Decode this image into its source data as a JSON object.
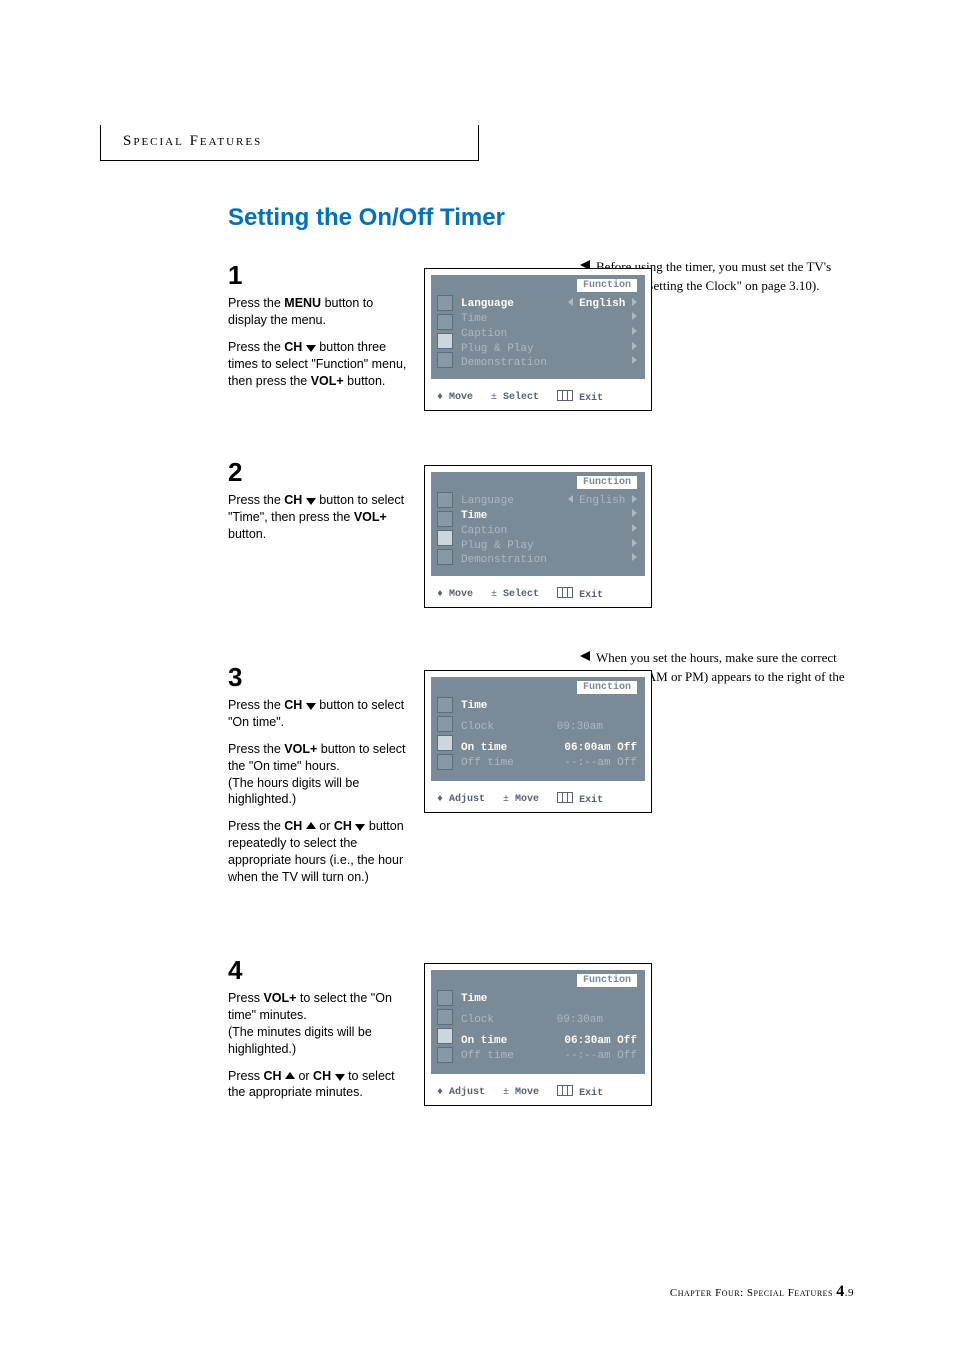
{
  "header": {
    "tab": "Special Features"
  },
  "title": "Setting the On/Off Timer",
  "steps": {
    "s1": {
      "num": "1",
      "p1a": "Press the ",
      "p1b": "MENU",
      "p1c": " button to display the menu.",
      "p2a": "Press the ",
      "p2b": "CH",
      "p2c": " button three times to select \"Function\" menu, then press the ",
      "p2d": "VOL+",
      "p2e": " button.",
      "osd": {
        "title": "Function",
        "lines": [
          {
            "label": "Language",
            "value": "English",
            "arrows": "lr",
            "hl": true
          },
          {
            "label": "Time",
            "value": "",
            "arrows": "r",
            "hl": false
          },
          {
            "label": "Caption",
            "value": "",
            "arrows": "r",
            "hl": false
          },
          {
            "label": "Plug & Play",
            "value": "",
            "arrows": "r",
            "hl": false
          },
          {
            "label": "Demonstration",
            "value": "",
            "arrows": "r",
            "hl": false
          }
        ],
        "footer": {
          "a": "Move",
          "b": "Select",
          "c": "Exit"
        }
      }
    },
    "s2": {
      "num": "2",
      "p1a": "Press the ",
      "p1b": "CH",
      "p1c": " button to select \"Time\", then press the  ",
      "p1d": "VOL+",
      "p1e": " button.",
      "osd": {
        "title": "Function",
        "lines": [
          {
            "label": "Language",
            "value": "English",
            "arrows": "lr",
            "hl": false
          },
          {
            "label": "Time",
            "value": "",
            "arrows": "r",
            "hl": true
          },
          {
            "label": "Caption",
            "value": "",
            "arrows": "r",
            "hl": false
          },
          {
            "label": "Plug & Play",
            "value": "",
            "arrows": "r",
            "hl": false
          },
          {
            "label": "Demonstration",
            "value": "",
            "arrows": "r",
            "hl": false
          }
        ],
        "footer": {
          "a": "Move",
          "b": "Select",
          "c": "Exit"
        }
      }
    },
    "s3": {
      "num": "3",
      "p1a": "Press the ",
      "p1b": "CH",
      "p1c": " button  to select \"On time\".",
      "p2a": "Press the ",
      "p2b": "VOL+",
      "p2c": " button to select the \"On time\" hours.",
      "p2d": "(The hours digits will be highlighted.)",
      "p3a": "Press the ",
      "p3b": "CH",
      "p3c": " or ",
      "p3d": "CH",
      "p3e": " button  repeatedly to select the appropriate hours (i.e., the hour when the TV will turn on.)",
      "osd": {
        "title": "Function",
        "heading": "Time",
        "rows": [
          {
            "label": "Clock",
            "value": "09:30am",
            "hl": false
          },
          {
            "label": "On time",
            "value": "06:00am Off",
            "hl": true
          },
          {
            "label": "Off time",
            "value": "--:--am Off",
            "hl": false
          }
        ],
        "footer": {
          "a": "Adjust",
          "b": "Move",
          "c": "Exit"
        }
      }
    },
    "s4": {
      "num": "4",
      "p1a": "Press ",
      "p1b": "VOL+",
      "p1c": " to select the \"On time\" minutes.",
      "p1d": "(The minutes digits will be highlighted.)",
      "p2a": "Press ",
      "p2b": "CH",
      "p2c": " or ",
      "p2d": "CH",
      "p2e": " to select the appropriate minutes.",
      "osd": {
        "title": "Function",
        "heading": "Time",
        "rows": [
          {
            "label": "Clock",
            "value": "09:30am",
            "hl": false
          },
          {
            "label": "On time",
            "value": "06:30am Off",
            "hl": true
          },
          {
            "label": "Off time",
            "value": "--:--am Off",
            "hl": false
          }
        ],
        "footer": {
          "a": "Adjust",
          "b": "Move",
          "c": "Exit"
        }
      }
    }
  },
  "notes": {
    "n1": "Before using the timer, you must set the TV's clock. (See \"Setting the Clock\" on page 3.10).",
    "n3": "When you set the hours, make sure the correct time of day (AM or PM) appears to the right of the hour."
  },
  "footer": {
    "chapter": "Chapter Four: Special Features ",
    "page_major": "4",
    "page_minor": ".9"
  }
}
